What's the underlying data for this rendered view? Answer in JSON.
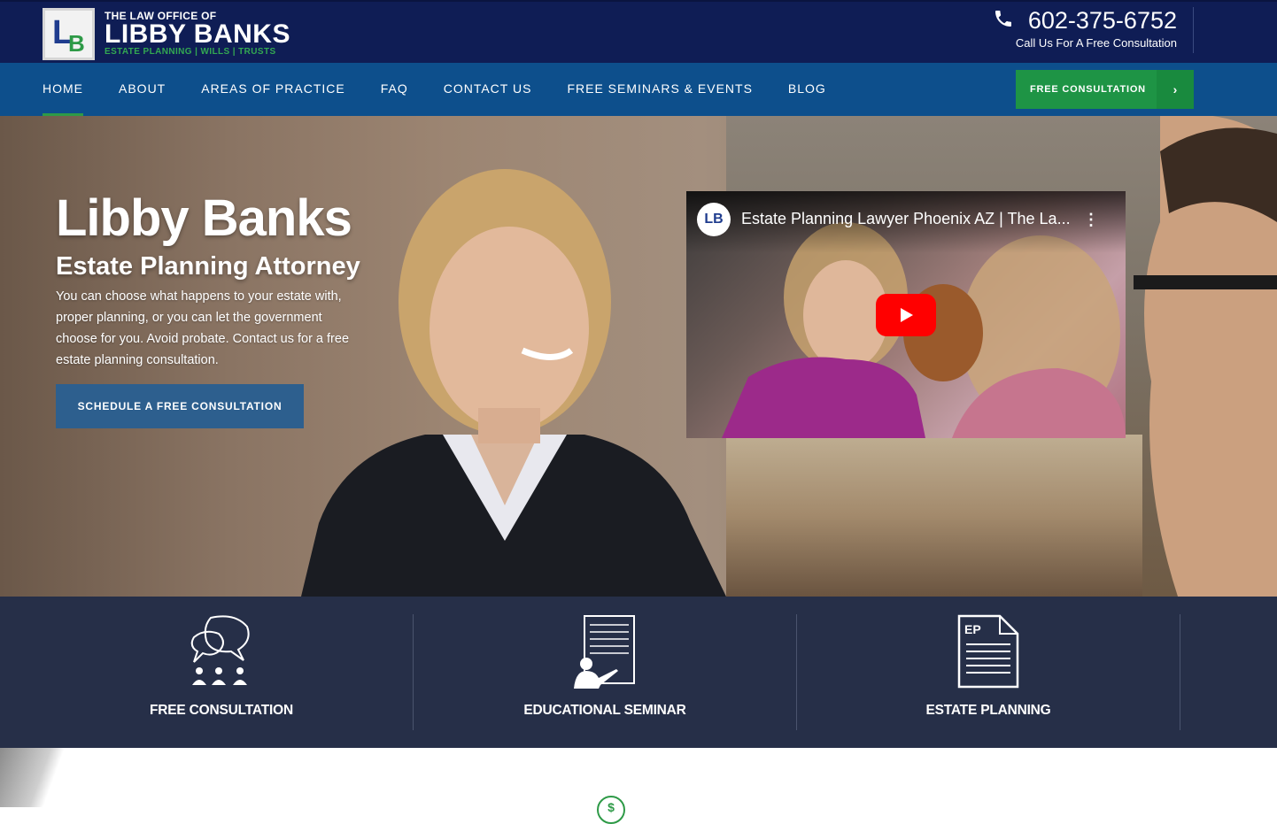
{
  "header": {
    "logo": {
      "mark_letters": "LB",
      "small_line": "THE LAW OFFICE OF",
      "name": "LIBBY BANKS",
      "tagline": "ESTATE PLANNING | WILLS | TRUSTS"
    },
    "phone": "602-375-6752",
    "phone_caption": "Call Us For A Free Consultation",
    "phone_icon": "phone-icon"
  },
  "nav": {
    "items": [
      {
        "label": "HOME"
      },
      {
        "label": "ABOUT"
      },
      {
        "label": "AREAS OF PRACTICE"
      },
      {
        "label": "FAQ"
      },
      {
        "label": "CONTACT US"
      },
      {
        "label": "FREE SEMINARS & EVENTS"
      },
      {
        "label": "BLOG"
      }
    ],
    "active_index": 0,
    "cta_label": "FREE CONSULTATION",
    "cta_icon": "chevron-right-icon"
  },
  "hero": {
    "title": "Libby Banks",
    "subtitle": "Estate Planning Attorney",
    "description": "You can choose what happens to your estate with, proper planning, or you can let the government choose for you. Avoid probate. Contact us for a free estate planning consultation.",
    "button_label": "SCHEDULE A FREE CONSULTATION"
  },
  "video": {
    "channel_letters": "LB",
    "title": "Estate Planning Lawyer Phoenix AZ | The La...",
    "menu_icon": "more-vert-icon",
    "play_icon": "youtube-play-icon"
  },
  "features": [
    {
      "label": "FREE CONSULTATION",
      "icon": "consultation-chat-icon"
    },
    {
      "label": "EDUCATIONAL SEMINAR",
      "icon": "seminar-presenter-icon"
    },
    {
      "label": "ESTATE PLANNING",
      "icon": "estate-document-icon"
    }
  ],
  "below": {
    "icon_glyph": "$",
    "icon": "dollar-circle-icon"
  },
  "colors": {
    "topbar": "#0f1d55",
    "nav": "#0d4f8c",
    "cta_green": "#1e9445",
    "hero_button": "#2d5f8e",
    "features_bg": "#262f48"
  }
}
